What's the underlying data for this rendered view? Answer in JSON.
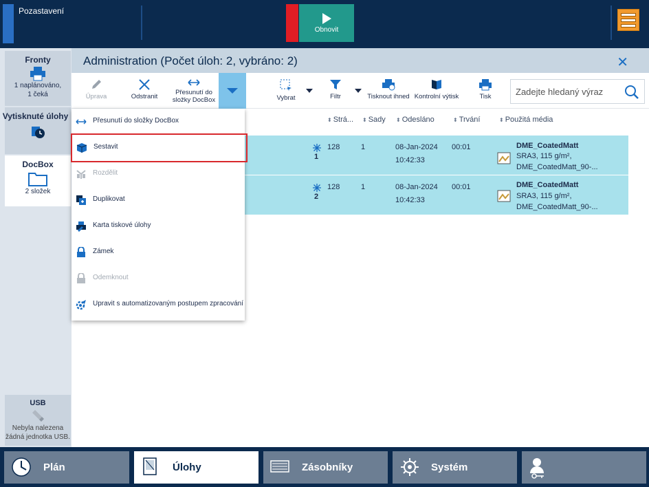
{
  "topbar": {
    "status": "Pozastavení",
    "resume_label": "Obnovit"
  },
  "sidebar": {
    "fronty": {
      "title": "Fronty",
      "line1": "1 naplánováno,",
      "line2": "1 čeká"
    },
    "printed": {
      "title": "Vytisknuté úlohy"
    },
    "docbox": {
      "title": "DocBox",
      "sub": "2 složek"
    },
    "usb": {
      "title": "USB",
      "line1": "Nebyla nalezena",
      "line2": "žádná jednotka USB."
    }
  },
  "header": {
    "title": "Administration (Počet úloh: 2, vybráno: 2)"
  },
  "toolbar": {
    "edit": "Úprava",
    "delete": "Odstranit",
    "move_line1": "Přesunutí do",
    "move_line2": "složky DocBox",
    "select": "Vybrat",
    "filter": "Filtr",
    "print_now": "Tisknout ihned",
    "proof": "Kontrolní výtisk",
    "print": "Tisk",
    "search_placeholder": "Zadejte hledaný výraz"
  },
  "columns": {
    "pages": "Strá...",
    "sets": "Sady",
    "sent": "Odesláno",
    "duration": "Trvání",
    "media": "Použitá média"
  },
  "jobs": [
    {
      "number": "1",
      "pages": "128",
      "sets": "1",
      "date": "08-Jan-2024",
      "time": "10:42:33",
      "duration": "00:01",
      "media_name": "DME_CoatedMatt",
      "media_spec": "SRA3, 115 g/m²,",
      "media_more": "DME_CoatedMatt_90-..."
    },
    {
      "number": "2",
      "pages": "128",
      "sets": "1",
      "date": "08-Jan-2024",
      "time": "10:42:33",
      "duration": "00:01",
      "media_name": "DME_CoatedMatt",
      "media_spec": "SRA3, 115 g/m²,",
      "media_more": "DME_CoatedMatt_90-..."
    }
  ],
  "dropdown": {
    "items": [
      {
        "label": "Přesunutí do složky DocBox",
        "icon": "move-arrows-icon",
        "enabled": true
      },
      {
        "label": "Sestavit",
        "icon": "assemble-cube-icon",
        "enabled": true,
        "highlighted": true
      },
      {
        "label": "Rozdělit",
        "icon": "split-icon",
        "enabled": false
      },
      {
        "label": "Duplikovat",
        "icon": "duplicate-icon",
        "enabled": true
      },
      {
        "label": "Karta tiskové úlohy",
        "icon": "job-ticket-icon",
        "enabled": true
      },
      {
        "label": "Zámek",
        "icon": "lock-icon",
        "enabled": true
      },
      {
        "label": "Odemknout",
        "icon": "unlock-icon",
        "enabled": false
      },
      {
        "label": "Upravit s automatizovaným postupem zpracování",
        "icon": "automated-workflow-icon",
        "enabled": true
      }
    ]
  },
  "bottom_tabs": [
    {
      "label": "Plán",
      "icon": "clock-icon",
      "active": false
    },
    {
      "label": "Úlohy",
      "icon": "jobs-document-icon",
      "active": true
    },
    {
      "label": "Zásobníky",
      "icon": "trays-icon",
      "active": false
    },
    {
      "label": "Systém",
      "icon": "gear-icon",
      "active": false
    },
    {
      "label": "",
      "icon": "user-key-icon",
      "active": false
    }
  ],
  "colors": {
    "dark_navy": "#0b2a4e",
    "selected_row": "#a8e1ec",
    "resume_green": "#22998c",
    "stop_red": "#e01d24",
    "accent_blue": "#1a6ec3",
    "highlight_red": "#d8282c"
  }
}
